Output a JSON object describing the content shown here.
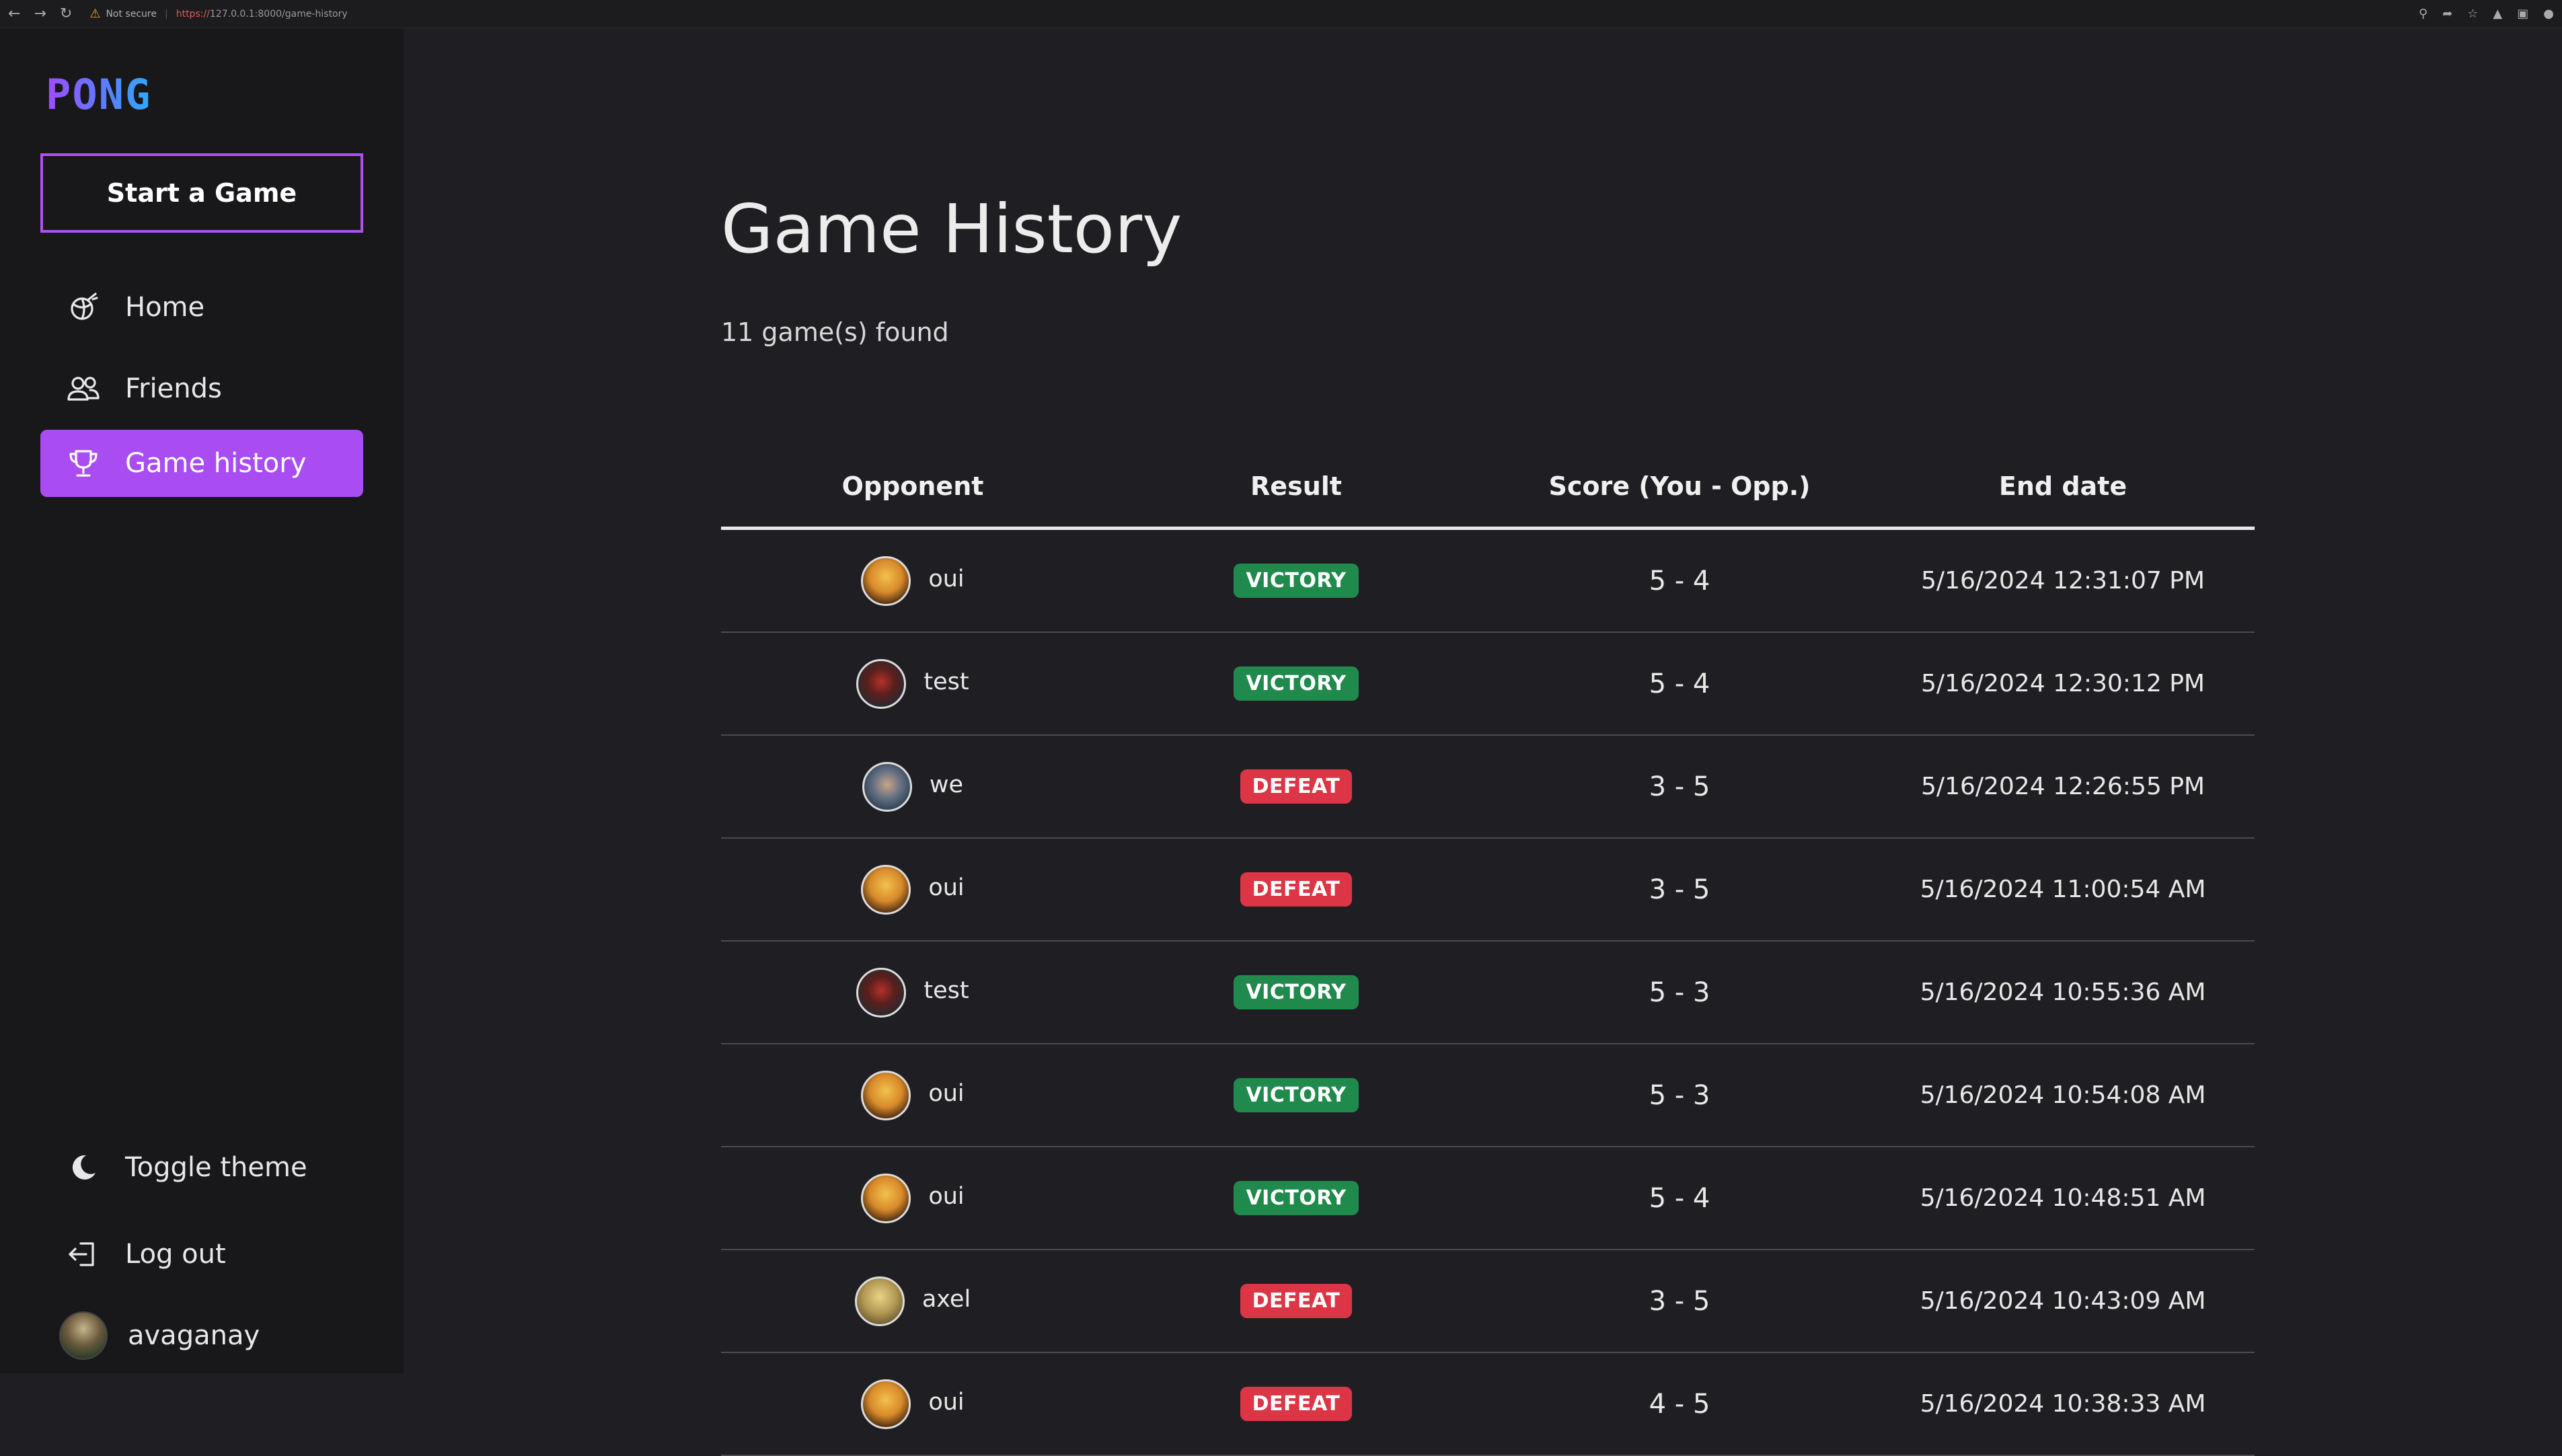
{
  "browser": {
    "security": "Not secure",
    "url_scheme": "https://",
    "url_rest": "127.0.0.1:8000/game-history"
  },
  "sidebar": {
    "logo": "PONG",
    "start_button": "Start a Game",
    "items": [
      {
        "label": "Home",
        "icon": "ball-icon"
      },
      {
        "label": "Friends",
        "icon": "users-icon"
      },
      {
        "label": "Game history",
        "icon": "trophy-icon",
        "active": true
      }
    ],
    "bottom": [
      {
        "label": "Toggle theme",
        "icon": "moon-icon"
      },
      {
        "label": "Log out",
        "icon": "logout-icon"
      },
      {
        "label": "avaganay",
        "icon": "avatar"
      }
    ]
  },
  "main": {
    "title": "Game History",
    "count": "11 game(s) found",
    "columns": [
      "Opponent",
      "Result",
      "Score (You - Opp.)",
      "End date"
    ],
    "rows": [
      {
        "opponent": "oui",
        "avatar": "oui",
        "result": "VICTORY",
        "score": "5 - 4",
        "date": "5/16/2024 12:31:07 PM"
      },
      {
        "opponent": "test",
        "avatar": "test",
        "result": "VICTORY",
        "score": "5 - 4",
        "date": "5/16/2024 12:30:12 PM"
      },
      {
        "opponent": "we",
        "avatar": "we",
        "result": "DEFEAT",
        "score": "3 - 5",
        "date": "5/16/2024 12:26:55 PM"
      },
      {
        "opponent": "oui",
        "avatar": "oui",
        "result": "DEFEAT",
        "score": "3 - 5",
        "date": "5/16/2024 11:00:54 AM"
      },
      {
        "opponent": "test",
        "avatar": "test",
        "result": "VICTORY",
        "score": "5 - 3",
        "date": "5/16/2024 10:55:36 AM"
      },
      {
        "opponent": "oui",
        "avatar": "oui",
        "result": "VICTORY",
        "score": "5 - 3",
        "date": "5/16/2024 10:54:08 AM"
      },
      {
        "opponent": "oui",
        "avatar": "oui",
        "result": "VICTORY",
        "score": "5 - 4",
        "date": "5/16/2024 10:48:51 AM"
      },
      {
        "opponent": "axel",
        "avatar": "axel",
        "result": "DEFEAT",
        "score": "3 - 5",
        "date": "5/16/2024 10:43:09 AM"
      },
      {
        "opponent": "oui",
        "avatar": "oui",
        "result": "DEFEAT",
        "score": "4 - 5",
        "date": "5/16/2024 10:38:33 AM"
      }
    ]
  },
  "colors": {
    "accent": "#a94cf2",
    "victory": "#1f8a4c",
    "defeat": "#dc3545"
  }
}
